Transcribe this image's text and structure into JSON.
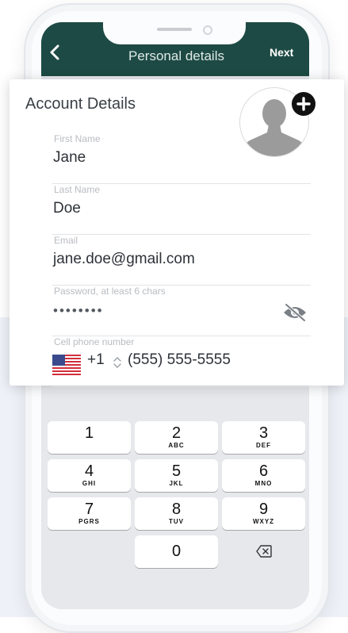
{
  "nav": {
    "title": "Personal details",
    "next_label": "Next"
  },
  "card": {
    "title": "Account Details",
    "fields": {
      "first_name": {
        "label": "First Name",
        "value": "Jane"
      },
      "last_name": {
        "label": "Last Name",
        "value": "Doe"
      },
      "email": {
        "label": "Email",
        "value": "jane.doe@gmail.com"
      },
      "password": {
        "label": "Password, at least 6 chars",
        "value": "••••••••"
      },
      "phone": {
        "label": "Cell phone number",
        "country_code": "+1",
        "value": "(555) 555-5555"
      }
    }
  },
  "keypad": {
    "keys": [
      {
        "num": "1",
        "letters": ""
      },
      {
        "num": "2",
        "letters": "ABC"
      },
      {
        "num": "3",
        "letters": "DEF"
      },
      {
        "num": "4",
        "letters": "GHI"
      },
      {
        "num": "5",
        "letters": "JKL"
      },
      {
        "num": "6",
        "letters": "MNO"
      },
      {
        "num": "7",
        "letters": "PGRS"
      },
      {
        "num": "8",
        "letters": "TUV"
      },
      {
        "num": "9",
        "letters": "WXYZ"
      },
      {
        "num": "0",
        "letters": ""
      }
    ]
  },
  "icons": {
    "back": "chevron-left-icon",
    "add_photo": "plus-icon",
    "avatar": "person-silhouette-icon",
    "password_toggle": "eye-off-icon",
    "flag": "us-flag-icon",
    "country_picker": "up-down-chevron-icon",
    "backspace": "backspace-icon"
  },
  "colors": {
    "nav_bar": "#1d4a44",
    "background_band": "#eef2f8",
    "keypad_bg": "#e6e8ec"
  }
}
